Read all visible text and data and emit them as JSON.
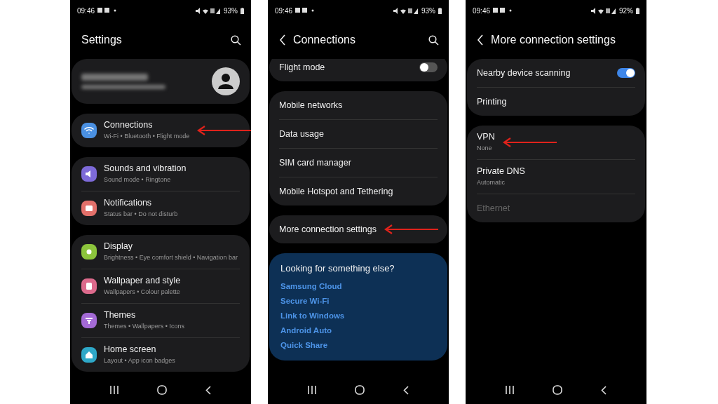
{
  "screens": [
    {
      "status_bar": {
        "time": "09:46",
        "battery": "93%"
      },
      "header": {
        "title": "Settings",
        "back": false,
        "search": true
      },
      "groups": [
        {
          "kind": "profile"
        },
        {
          "kind": "list",
          "items": [
            {
              "title": "Connections",
              "subtitle": "Wi-Fi  •  Bluetooth  •  Flight mode",
              "color": "#4a90e2",
              "arrow": true
            }
          ]
        },
        {
          "kind": "list",
          "items": [
            {
              "title": "Sounds and vibration",
              "subtitle": "Sound mode  •  Ringtone",
              "color": "#7d6ad8",
              "arrow": false
            },
            {
              "title": "Notifications",
              "subtitle": "Status bar  •  Do not disturb",
              "color": "#e2706a",
              "arrow": false
            }
          ]
        },
        {
          "kind": "list",
          "items": [
            {
              "title": "Display",
              "subtitle": "Brightness  •  Eye comfort shield  •  Navigation bar",
              "color": "#8cc43c",
              "arrow": false
            },
            {
              "title": "Wallpaper and style",
              "subtitle": "Wallpapers  •  Colour palette",
              "color": "#dc6a8c",
              "arrow": false
            },
            {
              "title": "Themes",
              "subtitle": "Themes  •  Wallpapers  •  Icons",
              "color": "#a46ad6",
              "arrow": false
            },
            {
              "title": "Home screen",
              "subtitle": "Layout  •  App icon badges",
              "color": "#2ea8c8",
              "arrow": false
            }
          ]
        }
      ]
    },
    {
      "status_bar": {
        "time": "09:46",
        "battery": "93%"
      },
      "header": {
        "title": "Connections",
        "back": true,
        "search": true
      },
      "groups": [
        {
          "kind": "cut",
          "items": [
            {
              "title": "Flight mode",
              "kind": "toggle",
              "on": false
            }
          ]
        },
        {
          "kind": "list",
          "items": [
            {
              "title": "Mobile networks",
              "arrow": false
            },
            {
              "title": "Data usage",
              "arrow": false
            },
            {
              "title": "SIM card manager",
              "arrow": false
            },
            {
              "title": "Mobile Hotspot and Tethering",
              "arrow": false
            }
          ]
        },
        {
          "kind": "list",
          "items": [
            {
              "title": "More connection settings",
              "arrow": true
            }
          ]
        },
        {
          "kind": "links",
          "title": "Looking for something else?",
          "items": [
            {
              "title": "Samsung Cloud"
            },
            {
              "title": "Secure Wi-Fi"
            },
            {
              "title": "Link to Windows"
            },
            {
              "title": "Android Auto"
            },
            {
              "title": "Quick Share"
            }
          ]
        }
      ]
    },
    {
      "status_bar": {
        "time": "09:46",
        "battery": "92%"
      },
      "header": {
        "title": "More connection settings",
        "back": true,
        "search": false
      },
      "groups": [
        {
          "kind": "list",
          "items": [
            {
              "title": "Nearby device scanning",
              "kind": "toggle",
              "on": true,
              "disabled": false
            },
            {
              "title": "Printing",
              "disabled": false
            }
          ]
        },
        {
          "kind": "list",
          "items": [
            {
              "title": "VPN",
              "subtitle": "None",
              "arrow": true,
              "disabled": false
            },
            {
              "title": "Private DNS",
              "subtitle": "Automatic",
              "arrow": false,
              "disabled": false
            },
            {
              "title": "Ethernet",
              "arrow": false,
              "disabled": true
            }
          ]
        }
      ]
    }
  ]
}
